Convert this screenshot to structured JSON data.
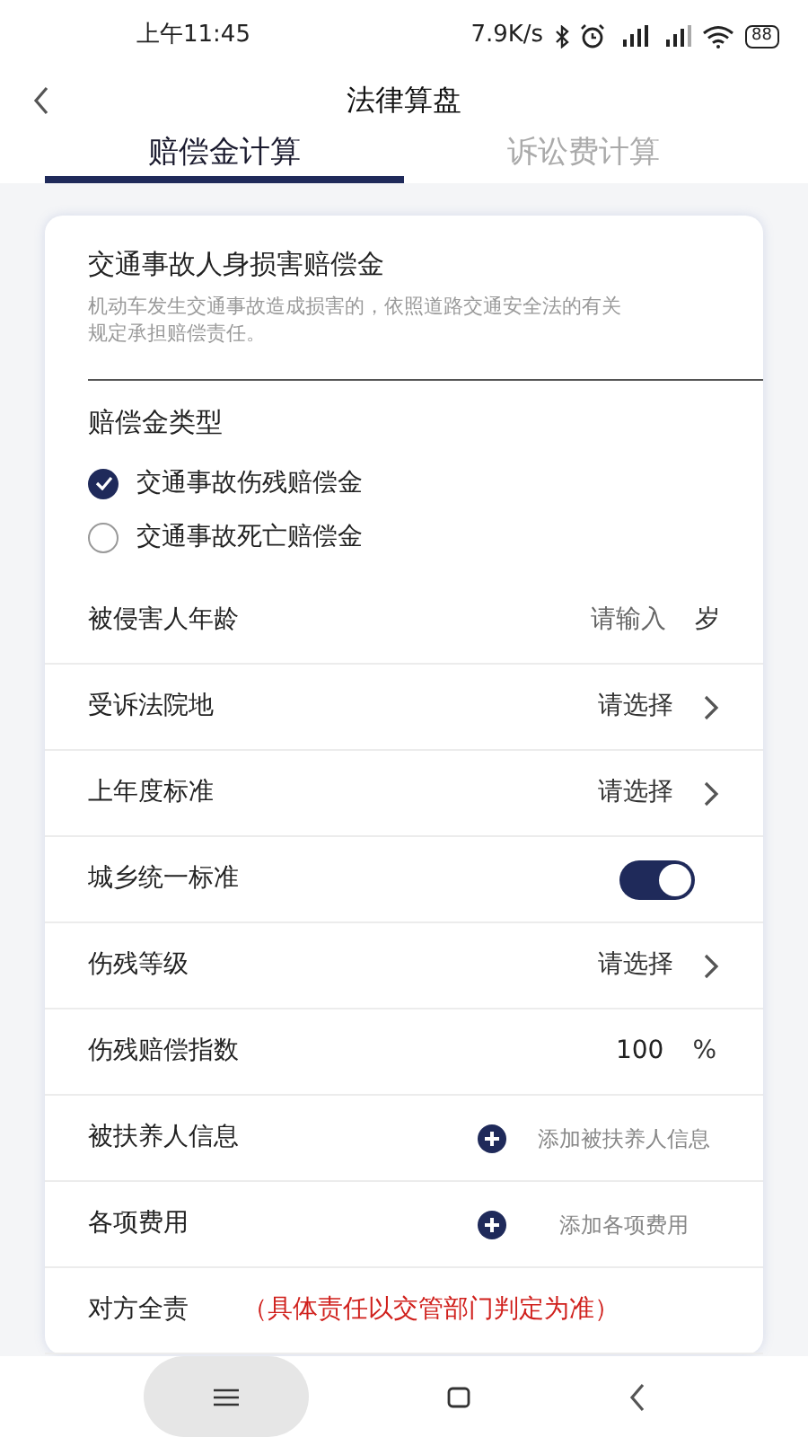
{
  "status_bar": {
    "time": "上午11:45",
    "speed": "7.9K/s",
    "battery": "88"
  },
  "header": {
    "title": "法律算盘"
  },
  "tabs": [
    {
      "label": "赔偿金计算",
      "selected": true
    },
    {
      "label": "诉讼费计算",
      "selected": false
    }
  ],
  "card": {
    "title": "交通事故人身损害赔偿金",
    "description": "机动车发生交通事故造成损害的，依照道路交通安全法的有关规定承担赔偿责任。",
    "type_section": {
      "label": "赔偿金类型",
      "options": [
        {
          "label": "交通事故伤残赔偿金",
          "selected": true
        },
        {
          "label": "交通事故死亡赔偿金",
          "selected": false
        }
      ]
    },
    "rows": [
      {
        "kind": "input",
        "label": "被侵害人年龄",
        "placeholder": "请输入",
        "unit": "岁"
      },
      {
        "kind": "select",
        "label": "受诉法院地",
        "value": "请选择"
      },
      {
        "kind": "select",
        "label": "上年度标准",
        "value": "请选择"
      },
      {
        "kind": "toggle",
        "label": "城乡统一标准",
        "on": true
      },
      {
        "kind": "select",
        "label": "伤残等级",
        "value": "请选择"
      },
      {
        "kind": "number",
        "label": "伤残赔偿指数",
        "value": "100",
        "unit": "%"
      },
      {
        "kind": "add",
        "label": "被扶养人信息",
        "action": "添加被扶养人信息"
      },
      {
        "kind": "add",
        "label": "各项费用",
        "action": "添加各项费用"
      },
      {
        "kind": "note",
        "label": "对方全责",
        "note": "（具体责任以交管部门判定为准）"
      }
    ]
  }
}
